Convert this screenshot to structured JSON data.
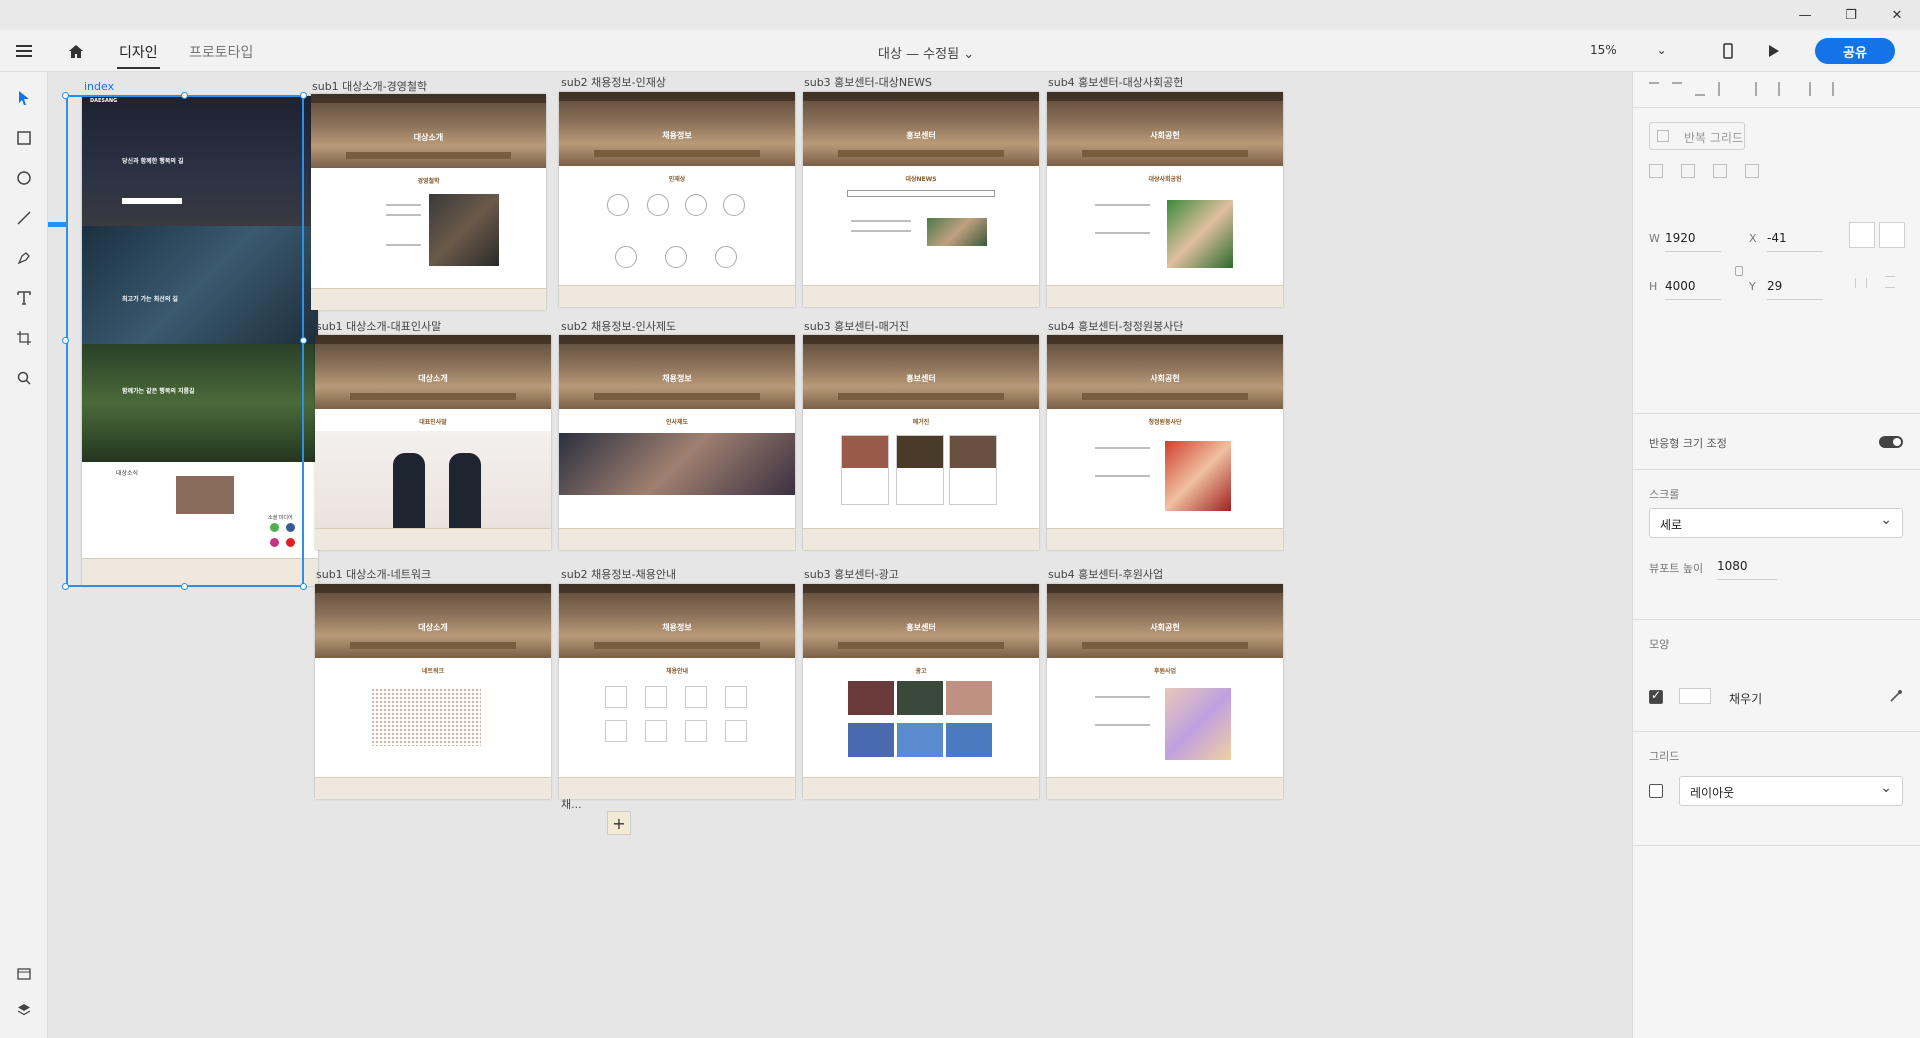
{
  "window": {
    "minimize": "—",
    "maximize": "❐",
    "close": "✕"
  },
  "appbar": {
    "tabs": [
      {
        "label": "디자인"
      },
      {
        "label": "프로토타입"
      }
    ],
    "doc_title": "대상 — 수정됨",
    "zoom": "15%",
    "share": "공유"
  },
  "canvas": {
    "index_label": "index",
    "artboards": [
      {
        "label": "sub1 대상소개-경영철학",
        "hero": "대상소개",
        "section": "경영철학"
      },
      {
        "label": "sub2 채용정보-인재상",
        "hero": "채용정보",
        "section": "인재상"
      },
      {
        "label": "sub3 홍보센터-대상NEWS",
        "hero": "홍보센터",
        "section": "대상NEWS"
      },
      {
        "label": "sub4 홍보센터-대상사회공헌",
        "hero": "사회공헌",
        "section": "대상사회공헌"
      },
      {
        "label": "sub1 대상소개-대표인사말",
        "hero": "대상소개",
        "section": "대표인사말"
      },
      {
        "label": "sub2 채용정보-인사제도",
        "hero": "채용정보",
        "section": "인사제도"
      },
      {
        "label": "sub3 홍보센터-매거진",
        "hero": "홍보센터",
        "section": "매거진"
      },
      {
        "label": "sub4 홍보센터-청정원봉사단",
        "hero": "사회공헌",
        "section": "청정원봉사단"
      },
      {
        "label": "sub1 대상소개-네트워크",
        "hero": "대상소개",
        "section": "네트워크"
      },
      {
        "label": "sub2 채용정보-채용안내",
        "hero": "채용정보",
        "section": "채용안내"
      },
      {
        "label": "sub3 홍보센터-광고",
        "hero": "홍보센터",
        "section": "광고"
      },
      {
        "label": "sub4 홍보센터-후원사업",
        "hero": "사회공헌",
        "section": "후원사업"
      }
    ],
    "index_page": {
      "logo": "DAESANG",
      "hero1": "당신과 함께한 행복의 길",
      "hero2": "최고가 가는 최선의 길",
      "hero3": "함께가는 같은 행복의 지름길",
      "news_title": "대상소식",
      "social_title": "소셜 미디어"
    },
    "add_label": "+",
    "partial_label": "채..."
  },
  "panel": {
    "repeat_grid": "반복 그리드",
    "w_label": "W",
    "w_value": "1920",
    "h_label": "H",
    "h_value": "4000",
    "x_label": "X",
    "x_value": "-41",
    "y_label": "Y",
    "y_value": "29",
    "responsive": "반응형 크기 조정",
    "scroll_title": "스크롤",
    "scroll_value": "세로",
    "viewport_label": "뷰포트 높이",
    "viewport_value": "1080",
    "appearance_title": "모양",
    "fill_label": "채우기",
    "fill_color": "#ffffff",
    "grid_title": "그리드",
    "grid_value": "레이아웃"
  },
  "colors": {
    "accent": "#1473e6",
    "selection": "#2c8fe8"
  }
}
